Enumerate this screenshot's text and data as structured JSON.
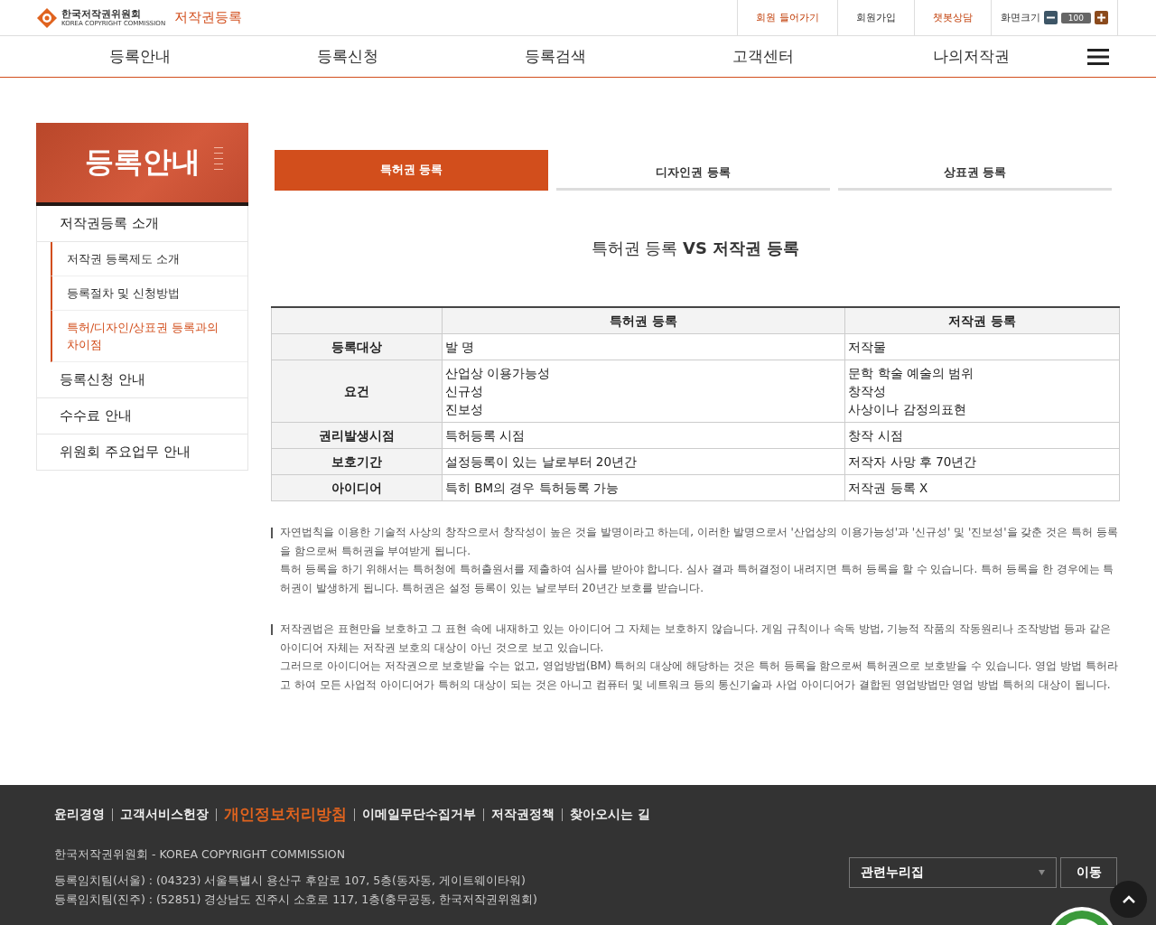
{
  "header": {
    "logo_name": "한국저작권위원회",
    "logo_sub": "KOREA COPYRIGHT COMMISSION",
    "site_title": "저작권등록",
    "utility_links": [
      {
        "label": "회원 들어가기",
        "highlight": true
      },
      {
        "label": "회원가입",
        "highlight": false
      },
      {
        "label": "챗봇상담",
        "highlight": true
      }
    ],
    "font_size": {
      "label": "화면크기",
      "value": "100"
    }
  },
  "nav": [
    "등록안내",
    "등록신청",
    "등록검색",
    "고객센터",
    "나의저작권"
  ],
  "sidebar": {
    "title": "등록안내",
    "items": [
      {
        "label": "저작권등록 소개",
        "children": [
          {
            "label": "저작권 등록제도 소개",
            "selected": false
          },
          {
            "label": "등록절차 및 신청방법",
            "selected": false
          },
          {
            "label": "특허/디자인/상표권 등록과의 차이점",
            "selected": true
          }
        ]
      },
      {
        "label": "등록신청 안내"
      },
      {
        "label": "수수료 안내"
      },
      {
        "label": "위원회 주요업무 안내"
      }
    ]
  },
  "tabs": [
    {
      "label": "특허권 등록",
      "selected": true
    },
    {
      "label": "디자인권 등록",
      "selected": false
    },
    {
      "label": "상표권 등록",
      "selected": false
    }
  ],
  "heading": "특허권 등록 **VS 저작권 등록**",
  "table": {
    "columns": [
      "특허권 등록",
      "저작권 등록"
    ],
    "rows": [
      {
        "label": "등록대상",
        "patent": [
          "발 명"
        ],
        "copyright": [
          "저작물"
        ]
      },
      {
        "label": "요건",
        "patent": [
          "산업상 이용가능성",
          "신규성",
          "진보성"
        ],
        "copyright": [
          "문학 학술 예술의 범위",
          "창작성",
          "사상이나 감정의표현"
        ]
      },
      {
        "label": "권리발생시점",
        "patent": [
          "특허등록 시점"
        ],
        "copyright": [
          "창작 시점"
        ]
      },
      {
        "label": "보호기간",
        "patent": [
          "설정등록이 있는 날로부터 20년간"
        ],
        "copyright": [
          "저작자 사망 후 70년간"
        ]
      },
      {
        "label": "아이디어",
        "patent": [
          "특히 BM의 경우 특허등록 가능"
        ],
        "copyright": [
          "저작권 등록 X"
        ]
      }
    ]
  },
  "notes": [
    [
      "자연법칙을 이용한 기술적 사상의 창작으로서 창작성이 높은 것을 발명이라고 하는데, 이러한 발명으로서 '산업상의 이용가능성'과 '신규성' 및 '진보성'을 갖춘 것은 특허 등록을 함으로써 특허권을 부여받게 됩니다.",
      "특허 등록을 하기 위해서는 특허청에 특허출원서를 제출하여 심사를 받아야 합니다. 심사 결과 특허결정이 내려지면 특허 등록을 할 수 있습니다. 특허 등록을 한 경우에는 특허권이 발생하게 됩니다. 특허권은 설정 등록이 있는 날로부터 20년간 보호를 받습니다."
    ],
    [
      "저작권법은 표현만을 보호하고 그 표현 속에 내재하고 있는 아이디어 그 자체는 보호하지 않습니다. 게임 규칙이나 속독 방법, 기능적 작품의 작동원리나 조작방법 등과 같은 아이디어 자체는 저작권 보호의 대상이 아닌 것으로 보고 있습니다.",
      "그러므로 아이디어는 저작권으로 보호받을 수는 없고, 영업방법(BM) 특허의 대상에 해당하는 것은 특허 등록을 함으로써 특허권으로 보호받을 수 있습니다. 영업 방법 특허라고 하여 모든 사업적 아이디어가 특허의 대상이 되는 것은 아니고 컴퓨터 및 네트워크 등의 통신기술과 사업 아이디어가 결합된 영업방법만 영업 방법 특허의 대상이 됩니다."
    ]
  ],
  "footer": {
    "links": [
      {
        "label": "윤리경영",
        "highlight": false
      },
      {
        "label": "고객서비스헌장",
        "highlight": false
      },
      {
        "label": "개인정보처리방침",
        "highlight": true
      },
      {
        "label": "이메일무단수집거부",
        "highlight": false
      },
      {
        "label": "저작권정책",
        "highlight": false
      },
      {
        "label": "찾아오시는 길",
        "highlight": false
      }
    ],
    "lines": [
      "한국저작권위원회 - KOREA COPYRIGHT COMMISSION",
      "등록임치팀(서울) : (04323) 서울특별시 용산구 후암로 107, 5층(동자동, 게이트웨이타워)",
      "등록임치팀(진주) : (52851) 경상남도 진주시 소호로 117, 1층(충무공동, 한국저작권위원회)"
    ],
    "related_select": "관련누리집",
    "go_button": "이동"
  }
}
